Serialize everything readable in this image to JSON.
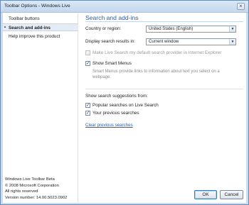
{
  "window": {
    "title": "Toolbar Options - Windows Live",
    "close_glyph": "×"
  },
  "nav": {
    "items": [
      {
        "label": "Toolbar buttons",
        "selected": false
      },
      {
        "label": "Search and add-ins",
        "selected": true
      },
      {
        "label": "Help improve this product",
        "selected": false
      }
    ],
    "footer": {
      "product": "Windows Live Toolbar Beta",
      "copyright": "© 2008 Microsoft Corporation",
      "rights": "All rights reserved",
      "version": "Version number: 14.00.5023.0902"
    }
  },
  "main": {
    "title": "Search and add-ins",
    "country_label": "Country or region:",
    "country_value": "United States (English)",
    "display_label": "Display search results in:",
    "display_value": "Current window",
    "default_provider_label": "Make Live Search my default search provider in Internet Explorer",
    "default_provider_checked": false,
    "smart_menus_label": "Show Smart Menus",
    "smart_menus_checked": true,
    "smart_menus_desc_1": "Smart Menus provide links to information about text you select on a",
    "smart_menus_desc_2": "webpage.",
    "suggestions_header": "Show search suggestions from:",
    "popular_label": "Popular searches on Live Search",
    "popular_checked": true,
    "previous_label": "Your previous searches",
    "previous_checked": true,
    "clear_link": "Clear previous searches"
  },
  "buttons": {
    "ok": "OK",
    "cancel": "Cancel"
  },
  "colors": {
    "accent_title": "#2b5ca8",
    "link": "#1f5fbf",
    "frame": "#c9ddf0"
  }
}
